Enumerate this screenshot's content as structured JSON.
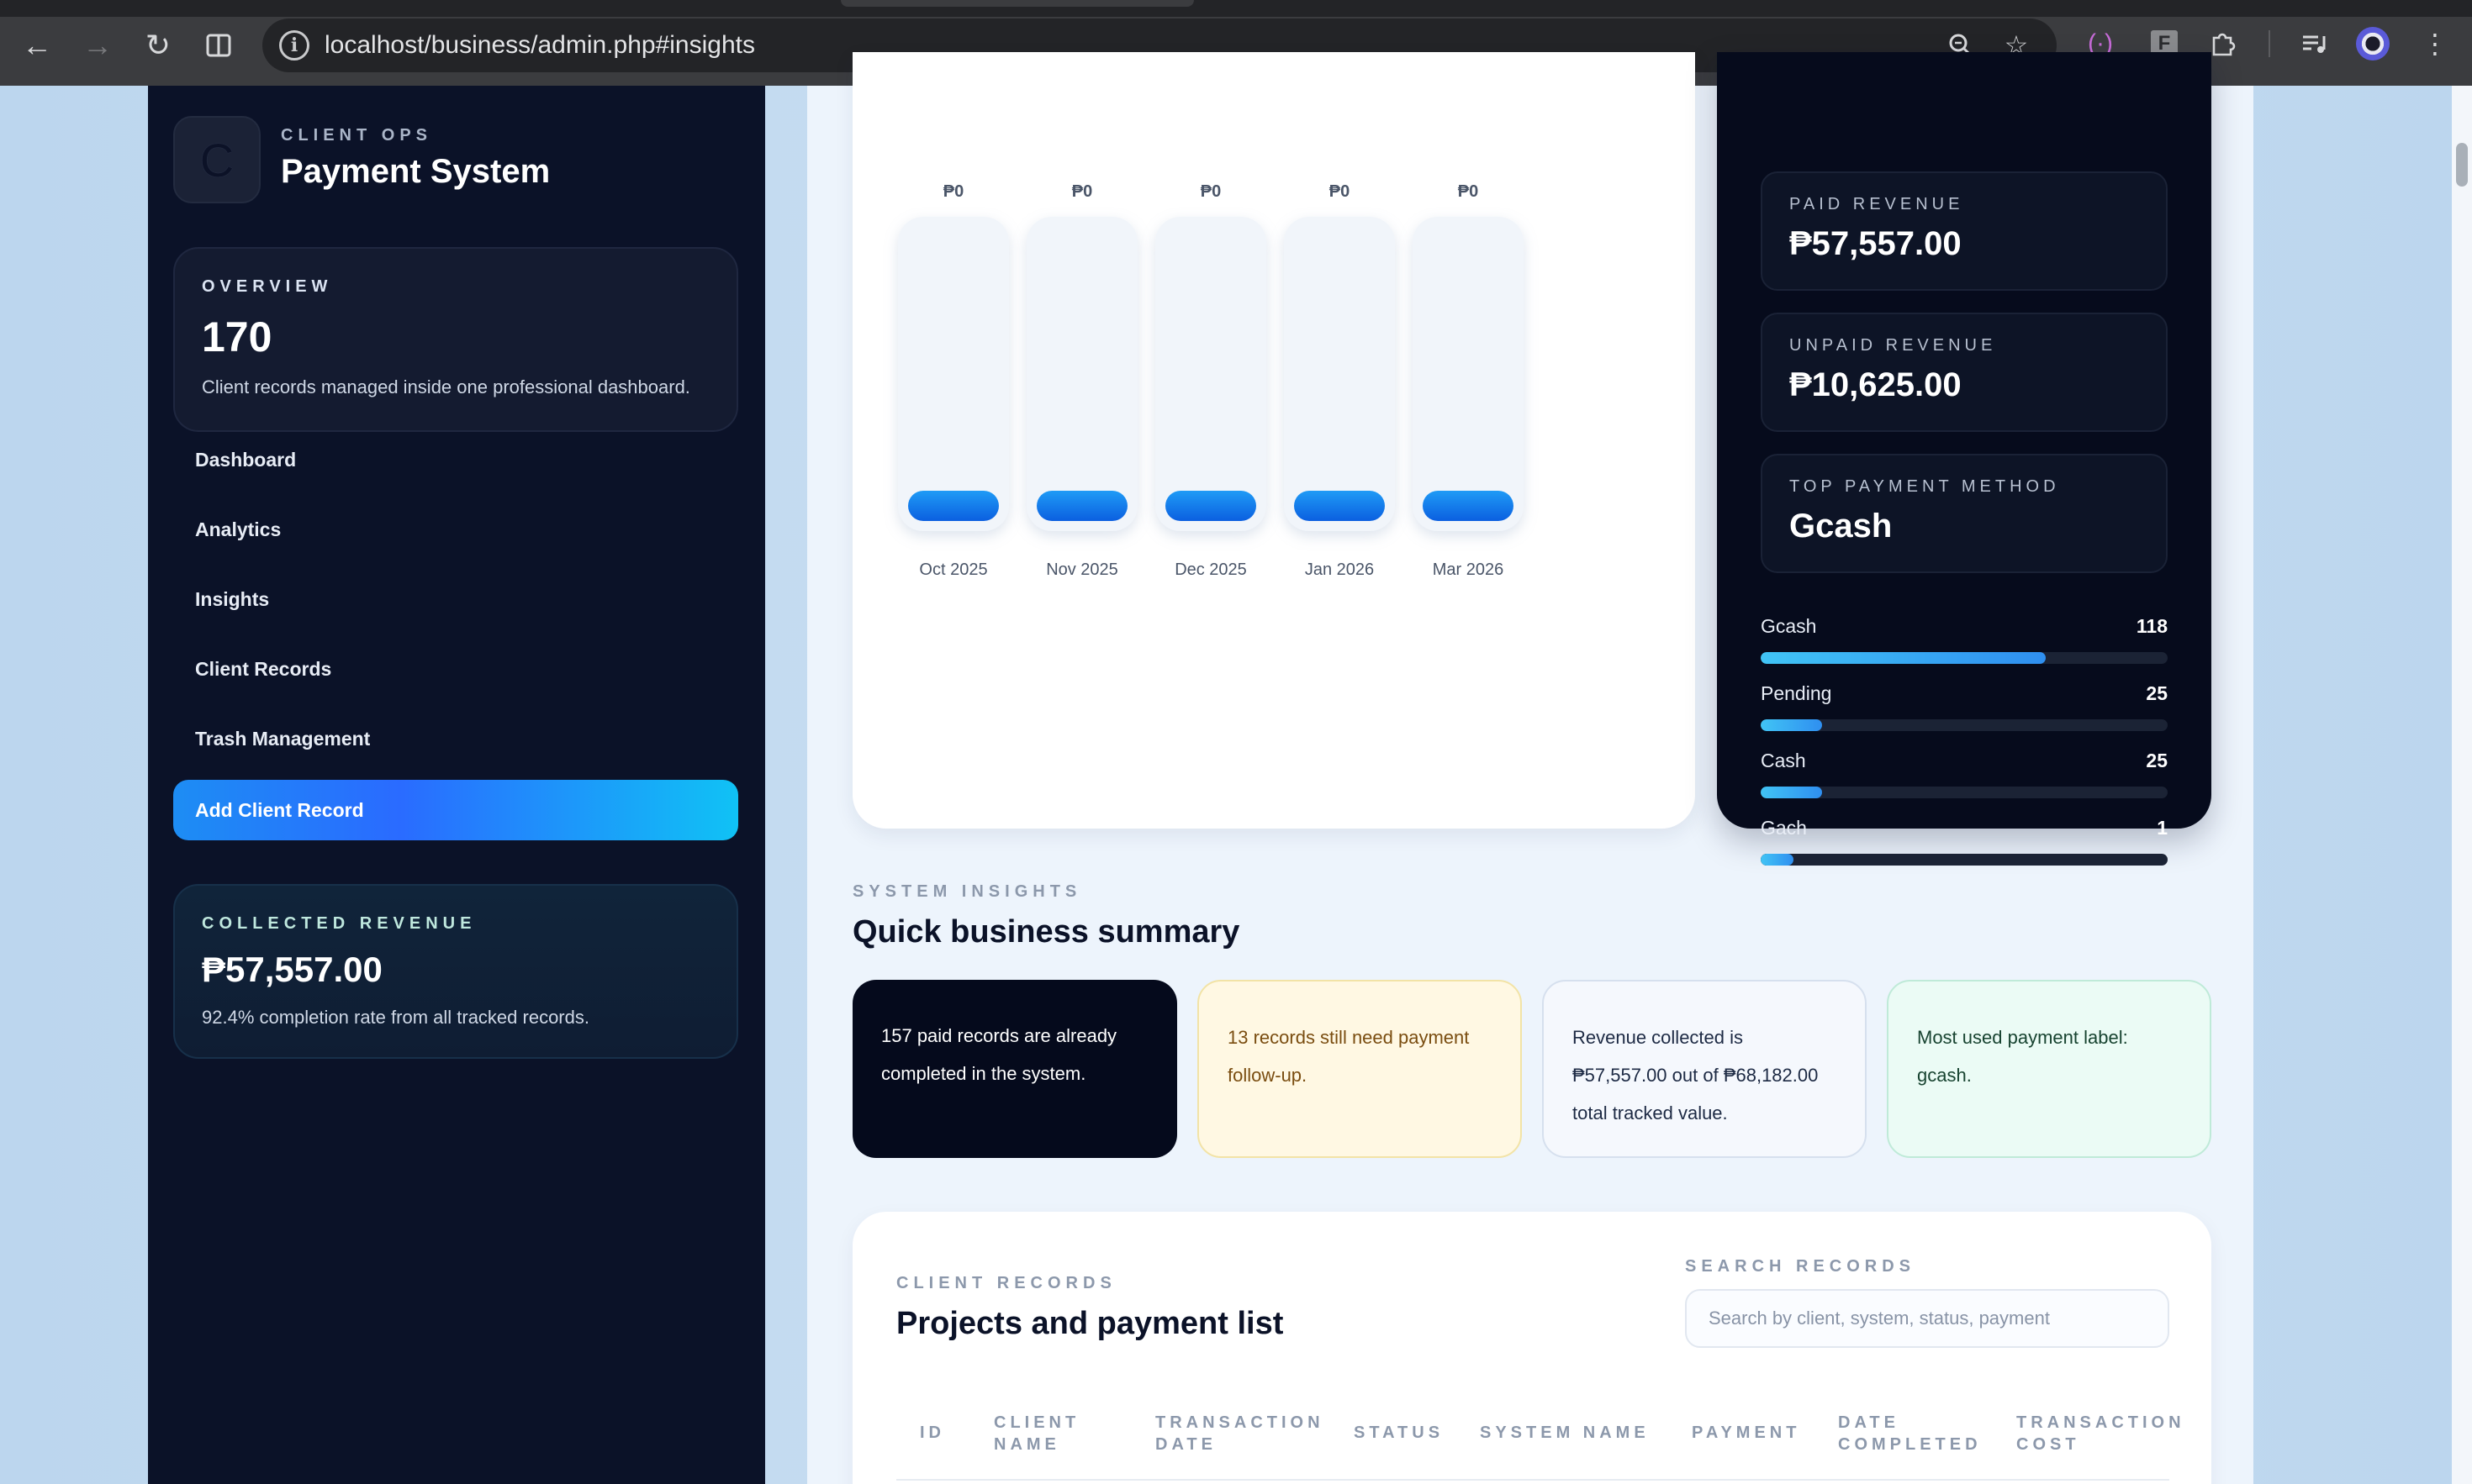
{
  "browser": {
    "url": "localhost/business/admin.php#insights",
    "back_icon": "arrow-left-icon",
    "forward_icon": "arrow-right-icon",
    "reload_icon": "reload-icon",
    "split_icon": "split-view-icon",
    "info_icon": "info-icon",
    "zoom_icon": "zoom-icon",
    "star_icon": "star-icon",
    "extension_f": "F"
  },
  "sidebar": {
    "logo_letter": "C",
    "kicker": "CLIENT OPS",
    "title": "Payment System",
    "overview": {
      "kicker": "OVERVIEW",
      "value": "170",
      "desc": "Client records managed inside one professional dashboard."
    },
    "nav": [
      {
        "label": "Dashboard"
      },
      {
        "label": "Analytics"
      },
      {
        "label": "Insights"
      },
      {
        "label": "Client Records"
      },
      {
        "label": "Trash Management"
      }
    ],
    "add_button": "Add Client Record",
    "collected": {
      "kicker": "COLLECTED REVENUE",
      "value": "₱57,557.00",
      "desc": "92.4% completion rate from all tracked records."
    }
  },
  "chart_data": {
    "type": "bar",
    "categories": [
      "Oct 2025",
      "Nov 2025",
      "Dec 2025",
      "Jan 2026",
      "Mar 2026"
    ],
    "values": [
      0,
      0,
      0,
      0,
      0
    ],
    "value_labels": [
      "₱0",
      "₱0",
      "₱0",
      "₱0",
      "₱0"
    ],
    "colors": {
      "track": "#f1f5fa",
      "bar_top": "#1f9bf6",
      "bar_bottom": "#0b5fe0"
    }
  },
  "stats": {
    "paid": {
      "kicker": "PAID REVENUE",
      "value": "₱57,557.00"
    },
    "unpaid": {
      "kicker": "UNPAID REVENUE",
      "value": "₱10,625.00"
    },
    "top_method": {
      "kicker": "TOP PAYMENT METHOD",
      "value": "Gcash"
    },
    "methods": [
      {
        "label": "Gcash",
        "count": "118",
        "fraction": 0.7
      },
      {
        "label": "Pending",
        "count": "25",
        "fraction": 0.15
      },
      {
        "label": "Cash",
        "count": "25",
        "fraction": 0.15
      },
      {
        "label": "Gach",
        "count": "1",
        "fraction": 0.08
      }
    ]
  },
  "insights": {
    "kicker": "SYSTEM INSIGHTS",
    "title": "Quick business summary",
    "cards": [
      {
        "text": "157 paid records are already completed in the system."
      },
      {
        "text": "13 records still need payment follow-up."
      },
      {
        "text": "Revenue collected is ₱57,557.00 out of ₱68,182.00 total tracked value."
      },
      {
        "text": "Most used payment label: gcash."
      }
    ]
  },
  "records": {
    "kicker": "CLIENT RECORDS",
    "title": "Projects and payment list",
    "search_kicker": "SEARCH RECORDS",
    "search_placeholder": "Search by client, system, status, payment",
    "columns": [
      {
        "line1": "ID",
        "line2": ""
      },
      {
        "line1": "CLIENT",
        "line2": "NAME"
      },
      {
        "line1": "TRANSACTION",
        "line2": "DATE"
      },
      {
        "line1": "STATUS",
        "line2": ""
      },
      {
        "line1": "SYSTEM NAME",
        "line2": ""
      },
      {
        "line1": "PAYMENT",
        "line2": ""
      },
      {
        "line1": "DATE",
        "line2": "COMPLETED"
      },
      {
        "line1": "TRANSACTION",
        "line2": "COST"
      }
    ]
  }
}
